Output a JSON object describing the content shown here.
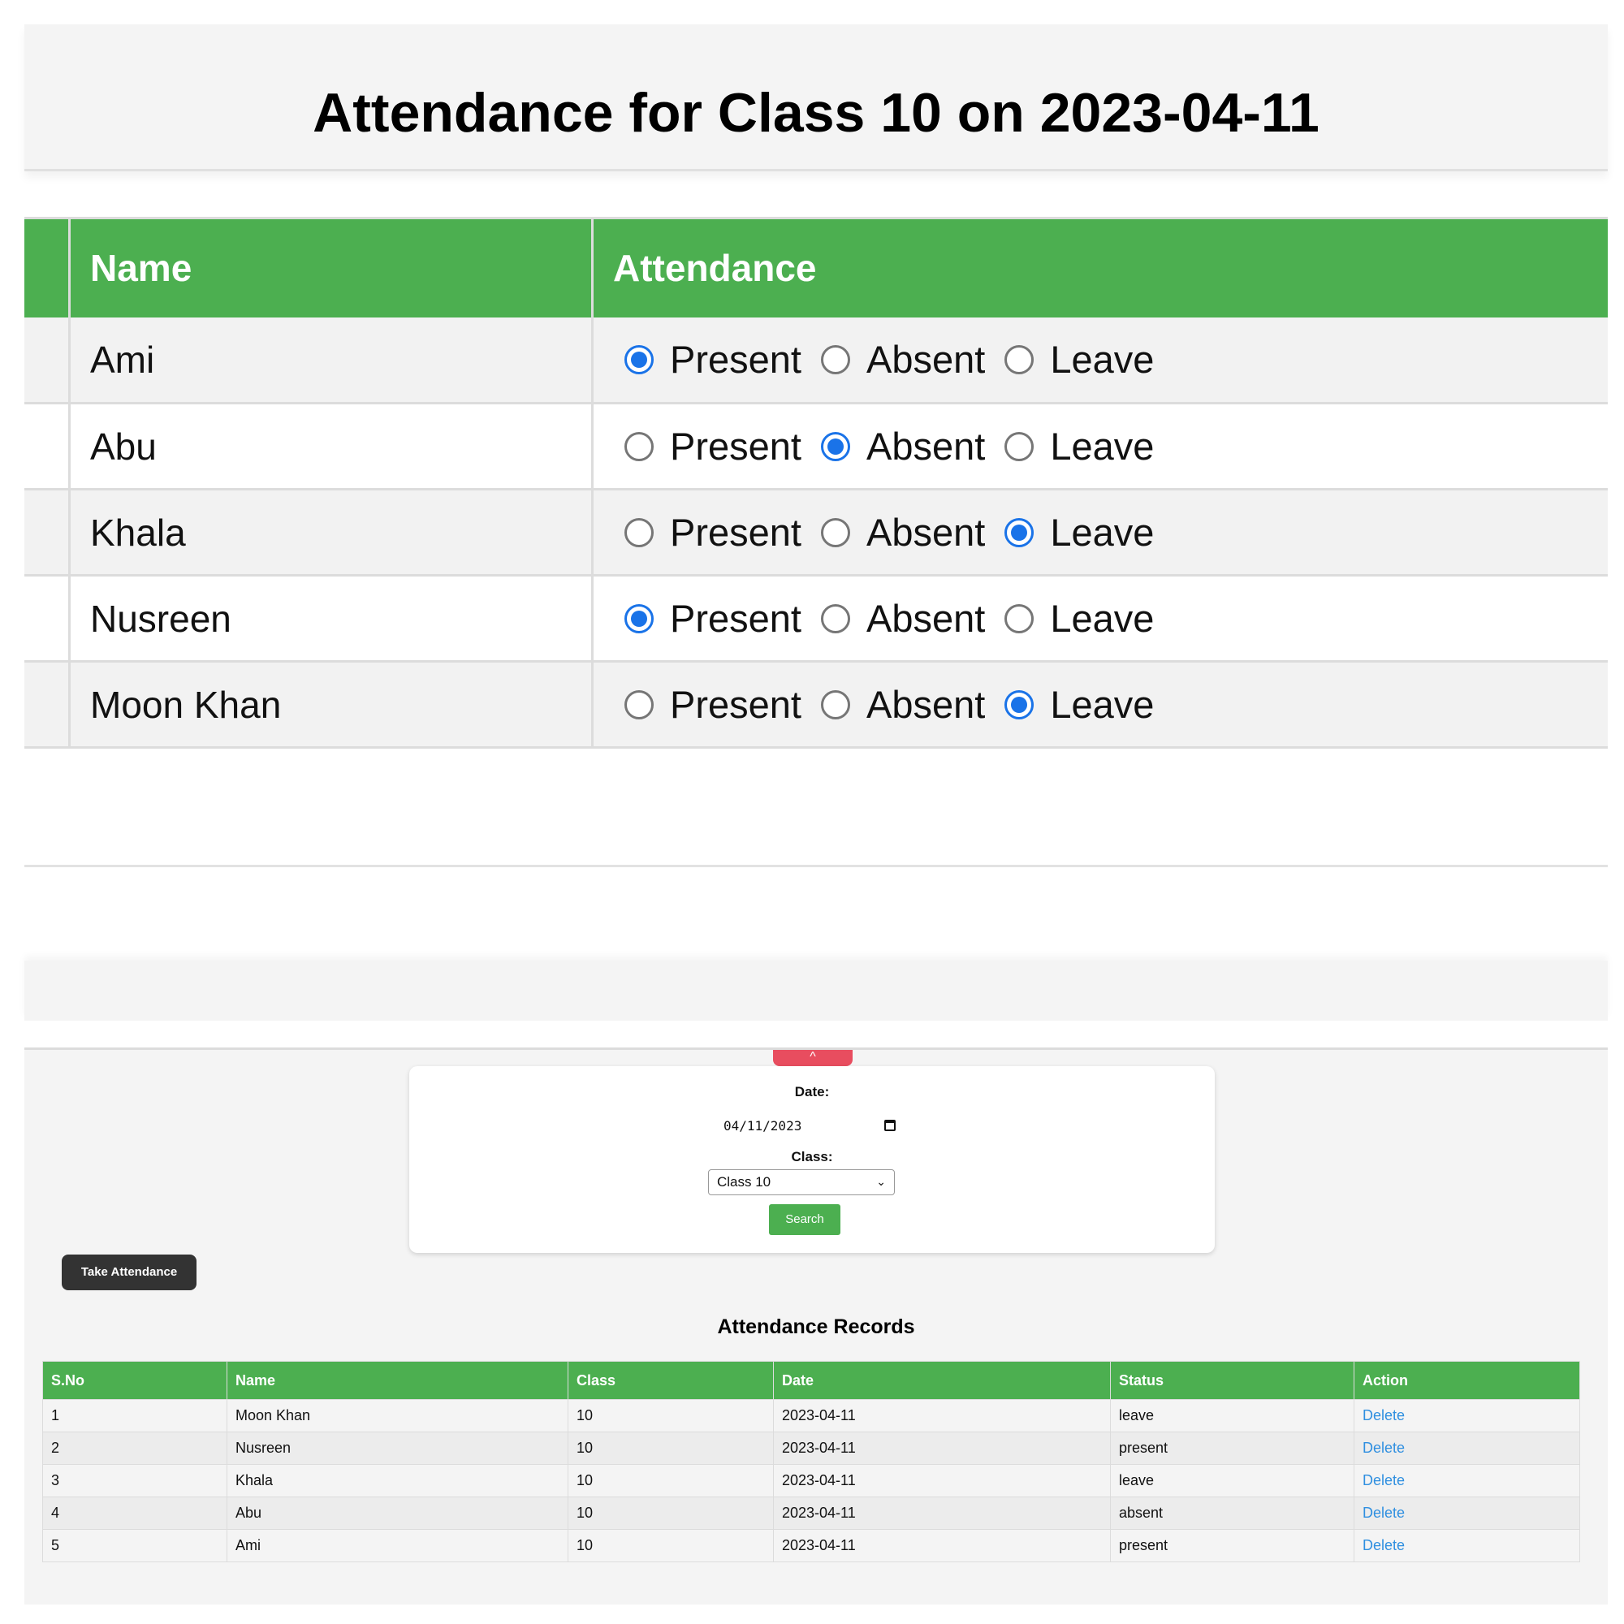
{
  "header": {
    "title": "Attendance for Class 10 on 2023-04-11"
  },
  "attendance_table": {
    "headers": {
      "name": "Name",
      "attendance": "Attendance"
    },
    "options": [
      "Present",
      "Absent",
      "Leave"
    ],
    "rows": [
      {
        "name": "Ami",
        "selected": "Present"
      },
      {
        "name": "Abu",
        "selected": "Absent"
      },
      {
        "name": "Khala",
        "selected": "Leave"
      },
      {
        "name": "Nusreen",
        "selected": "Present"
      },
      {
        "name": "Moon Khan",
        "selected": "Leave"
      }
    ]
  },
  "search_form": {
    "date_label": "Date:",
    "date_value": "04/11/2023",
    "class_label": "Class:",
    "class_value": "Class 10",
    "search_label": "Search",
    "toggle_icon": "chevron-up-icon"
  },
  "take_attendance_label": "Take Attendance",
  "records": {
    "title": "Attendance Records",
    "columns": [
      "S.No",
      "Name",
      "Class",
      "Date",
      "Status",
      "Action"
    ],
    "rows": [
      [
        "1",
        "Moon Khan",
        "10",
        "2023-04-11",
        "leave",
        "Delete"
      ],
      [
        "2",
        "Nusreen",
        "10",
        "2023-04-11",
        "present",
        "Delete"
      ],
      [
        "3",
        "Khala",
        "10",
        "2023-04-11",
        "leave",
        "Delete"
      ],
      [
        "4",
        "Abu",
        "10",
        "2023-04-11",
        "absent",
        "Delete"
      ],
      [
        "5",
        "Ami",
        "10",
        "2023-04-11",
        "present",
        "Delete"
      ]
    ]
  },
  "colors": {
    "accent_green": "#4caf50",
    "accent_red": "#e84d5f",
    "radio_blue": "#1a73e8",
    "link_blue": "#2f8fe0"
  }
}
